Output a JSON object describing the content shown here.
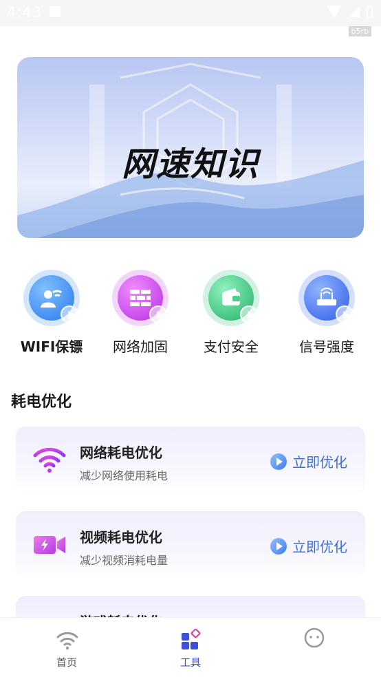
{
  "status_bar": {
    "time": "4:43"
  },
  "build_tag": "b5rb",
  "banner": {
    "title": "网速知识"
  },
  "tools": [
    {
      "label": "WIFI保镖",
      "icon": "wifi-guard-icon",
      "color": "#3b8ef0"
    },
    {
      "label": "网络加固",
      "icon": "firewall-icon",
      "color": "#c93be8"
    },
    {
      "label": "支付安全",
      "icon": "wallet-icon",
      "color": "#2fc07a"
    },
    {
      "label": "信号强度",
      "icon": "router-icon",
      "color": "#3d6df0"
    }
  ],
  "section": {
    "title": "耗电优化"
  },
  "cards": [
    {
      "title": "网络耗电优化",
      "subtitle": "减少网络使用耗电",
      "action": "立即优化",
      "icon": "wifi-icon"
    },
    {
      "title": "视频耗电优化",
      "subtitle": "减少视频消耗电量",
      "action": "立即优化",
      "icon": "video-camera-icon"
    },
    {
      "title": "游戏耗电优化",
      "subtitle": "",
      "action": "",
      "icon": "gamepad-icon"
    }
  ],
  "bottom_nav": [
    {
      "label": "首页",
      "icon": "wifi-icon",
      "active": false
    },
    {
      "label": "工具",
      "icon": "tools-grid-icon",
      "active": true
    },
    {
      "label": "",
      "icon": "smiley-icon",
      "active": false
    }
  ],
  "colors": {
    "accent": "#3d4fd6",
    "action_text": "#3d6fd6"
  }
}
